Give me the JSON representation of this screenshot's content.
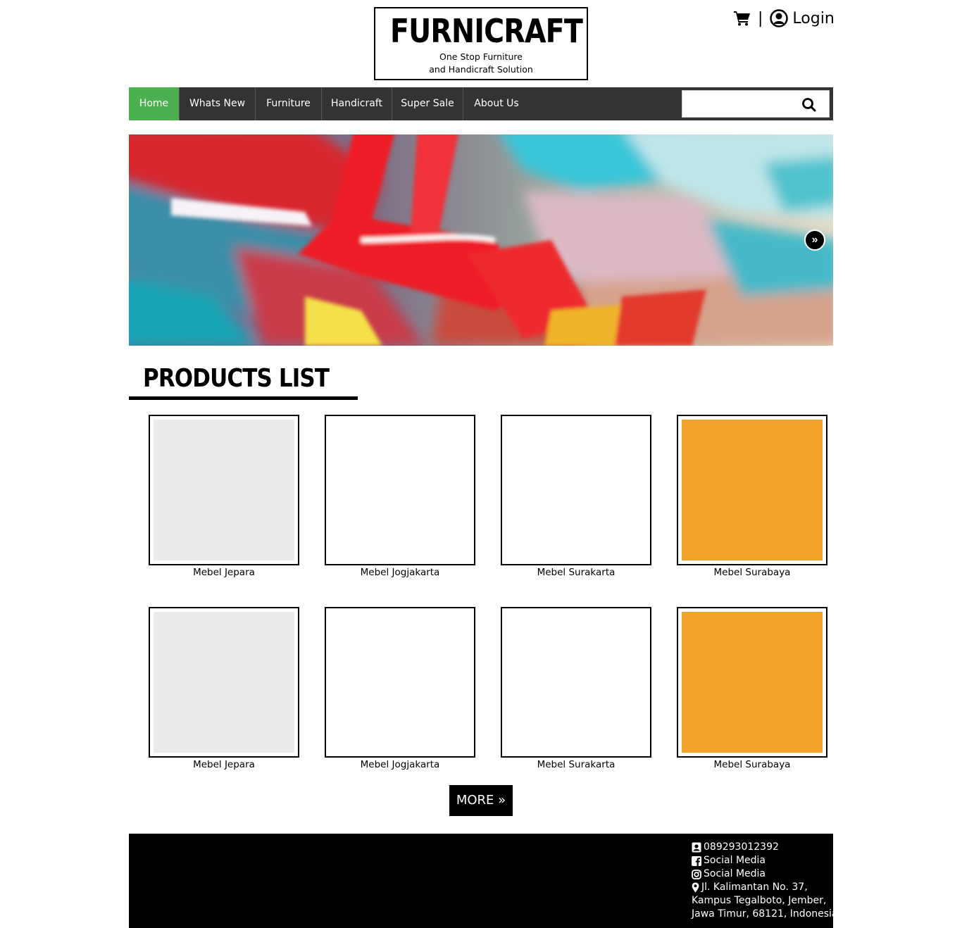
{
  "header": {
    "logo_title": "FURNICRAFT",
    "logo_tagline_1": "One Stop Furniture",
    "logo_tagline_2": "and Handicraft Solution",
    "separator": "|",
    "login_label": "Login"
  },
  "nav": {
    "items": [
      {
        "label": "Home",
        "active": true
      },
      {
        "label": "Whats New",
        "active": false
      },
      {
        "label": "Furniture",
        "active": false
      },
      {
        "label": "Handicraft",
        "active": false
      },
      {
        "label": "Super Sale",
        "active": false
      },
      {
        "label": "About Us",
        "active": false
      }
    ],
    "search_placeholder": "",
    "active_color": "#4caf50",
    "bar_color": "#333333"
  },
  "hero": {
    "next_label": "»",
    "image": "colorful-paint-abstract"
  },
  "products": {
    "title": "PRODUCTS LIST",
    "items": [
      {
        "name": "Mebel Jepara",
        "image": "wooden-sofa-set"
      },
      {
        "name": "Mebel Jogjakarta",
        "image": "wooden-cabinet"
      },
      {
        "name": "Mebel Surakarta",
        "image": "dining-set-chairs"
      },
      {
        "name": "Mebel Surabaya",
        "image": "round-table-chairs"
      },
      {
        "name": "Mebel Jepara",
        "image": "wooden-sofa-set"
      },
      {
        "name": "Mebel Jogjakarta",
        "image": "wooden-cabinet"
      },
      {
        "name": "Mebel Surakarta",
        "image": "dining-set-chairs"
      },
      {
        "name": "Mebel Surabaya",
        "image": "round-table-chairs"
      }
    ],
    "more_label": "MORE »"
  },
  "footer": {
    "phone": "089293012392",
    "facebook": "Social Media",
    "instagram": "Social Media",
    "address_1": "Jl. Kalimantan No. 37,",
    "address_2": "Kampus Tegalboto, Jember,",
    "address_3": "Jawa Timur, 68121, Indonesia"
  }
}
